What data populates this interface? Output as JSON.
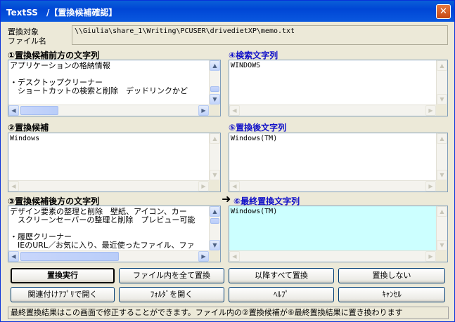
{
  "window": {
    "title": "TextSS　/【置換候補確認】",
    "close_label": "✕"
  },
  "target": {
    "label_line1": "置換対象",
    "label_line2": "ファイル名",
    "path": "\\\\Giulia\\share_1\\Writing\\PCUSER\\drivedietXP\\memo.txt"
  },
  "sections": {
    "before": {
      "heading": "①置換候補前方の文字列",
      "text": "アプリケーションの格納情報\n\n・デスクトップクリーナー\n　ショートカットの検索と削除　デッドリンクかど"
    },
    "search": {
      "heading": "④検索文字列",
      "text": "WINDOWS"
    },
    "candidate": {
      "heading": "②置換候補",
      "text": "Windows"
    },
    "after_replace": {
      "heading": "⑤置換後文字列",
      "text": "Windows(TM)"
    },
    "after": {
      "heading": "③置換候補後方の文字列",
      "text": "デザイン要素の整理と削除　壁紙、アイコン、カー\n　スクリーンセーバーの整理と削除　プレビュー可能\n\n・履歴クリーナー\n　IEのURL／お気に入り、最近使ったファイル、ファ"
    },
    "final": {
      "heading": "⑥最終置換文字列",
      "text": "Windows(TM)"
    }
  },
  "arrow": "➜",
  "buttons": {
    "execute": "置換実行",
    "replace_all_file": "ファイル内を全て置換",
    "replace_after": "以降すべて置換",
    "no_replace": "置換しない",
    "open_assoc": "関連付けｱﾌﾟﾘで開く",
    "open_folder": "ﾌｫﾙﾀﾞを開く",
    "help": "ﾍﾙﾌﾟ",
    "cancel": "ｷｬﾝｾﾙ"
  },
  "status": "最終置換結果はこの画面で修正することができます。ファイル内の②置換候補が⑥最終置換結果に置き換わります",
  "colors": {
    "title_bar": "#0a5fd8",
    "heading_blue": "#1010c8",
    "final_bg": "#ccffff"
  }
}
